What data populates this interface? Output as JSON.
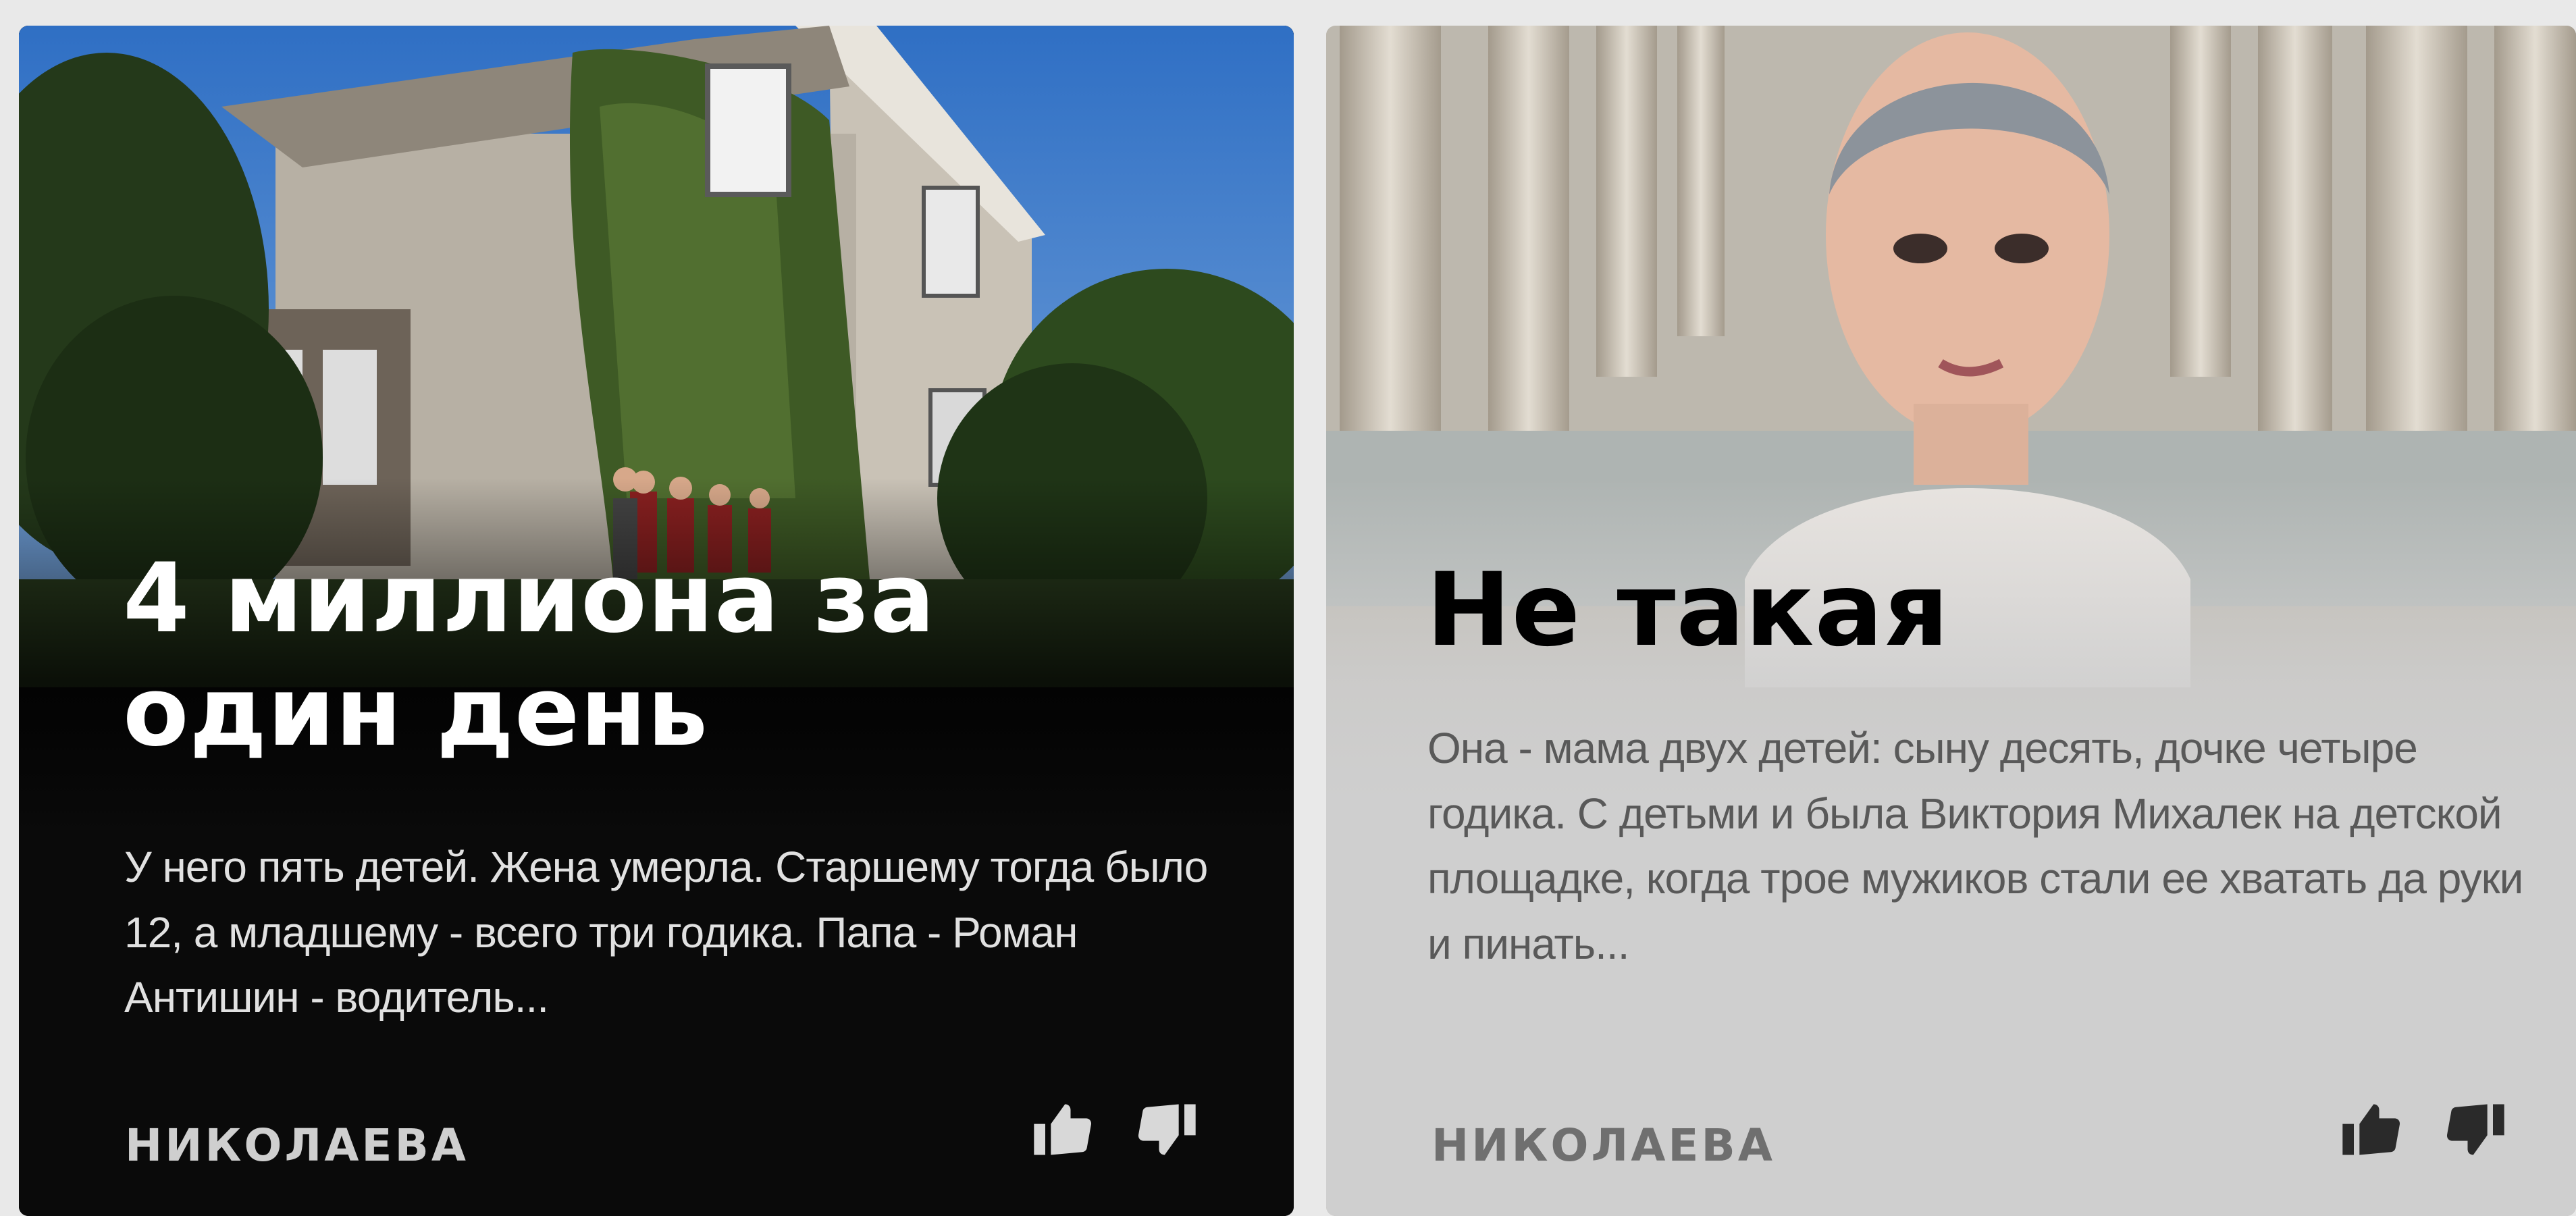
{
  "feed": {
    "cards": [
      {
        "title": "4 миллиона за один день",
        "excerpt": "У него пять детей. Жена умерла. Старшему тогда было 12, а младшему - всего три годика. Папа - Роман Антишин - водитель...",
        "source": "НИКОЛАЕВА",
        "like_icon": "thumbs-up-icon",
        "dislike_icon": "thumbs-down-icon",
        "theme": "dark",
        "colors": {
          "text": "#ffffff",
          "excerpt": "#e1e1e1",
          "source": "#cfcfcf"
        }
      },
      {
        "title": "Не такая",
        "excerpt": "Она - мама двух детей: сыну десять, дочке четыре годика. С детьми и была Виктория Михалек на детской площадке, когда трое мужиков стали ее хватать да руки и пинать...",
        "source": "НИКОЛАЕВА",
        "like_icon": "thumbs-up-icon",
        "dislike_icon": "thumbs-down-icon",
        "theme": "light",
        "colors": {
          "text": "#000000",
          "excerpt": "#595959",
          "source": "#6f6f6f"
        }
      }
    ]
  }
}
